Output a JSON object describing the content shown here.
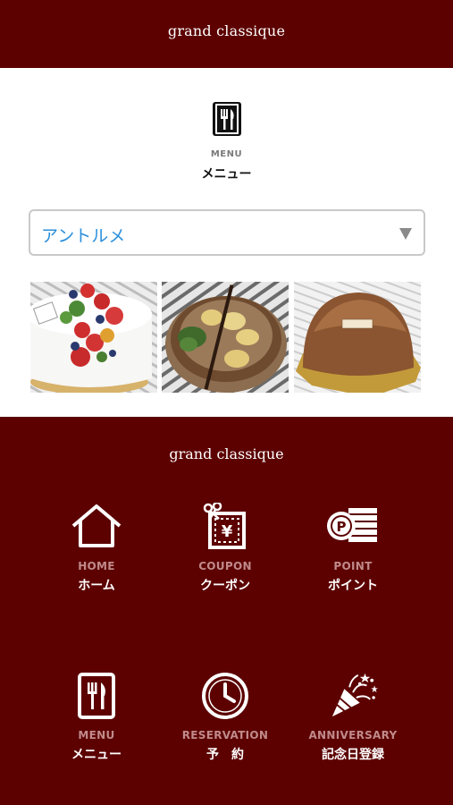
{
  "header": {
    "brand": "grand classique"
  },
  "menu_section": {
    "icon": "utensils-icon",
    "en_label": "MENU",
    "ja_label": "メニュー"
  },
  "category_select": {
    "value": "アントルメ",
    "icon": "dropdown-caret-icon"
  },
  "photos": [
    {
      "name": "strawberry-shortcake-photo"
    },
    {
      "name": "banana-chocolate-tart-photo"
    },
    {
      "name": "chocolate-dome-cake-photo"
    }
  ],
  "footer": {
    "brand": "grand classique",
    "nav": [
      {
        "en": "HOME",
        "ja": "ホーム",
        "icon": "home-icon"
      },
      {
        "en": "COUPON",
        "ja": "クーポン",
        "icon": "coupon-icon"
      },
      {
        "en": "POINT",
        "ja": "ポイント",
        "icon": "point-coins-icon"
      },
      {
        "en": "MENU",
        "ja": "メニュー",
        "icon": "utensils-icon"
      },
      {
        "en": "RESERVATION",
        "ja": "予　約",
        "icon": "clock-icon"
      },
      {
        "en": "ANNIVERSARY",
        "ja": "記念日登録",
        "icon": "party-popper-icon"
      }
    ]
  },
  "colors": {
    "primary": "#5c0000",
    "link": "#2a8fdc",
    "nav_en": "#c08a8a"
  }
}
